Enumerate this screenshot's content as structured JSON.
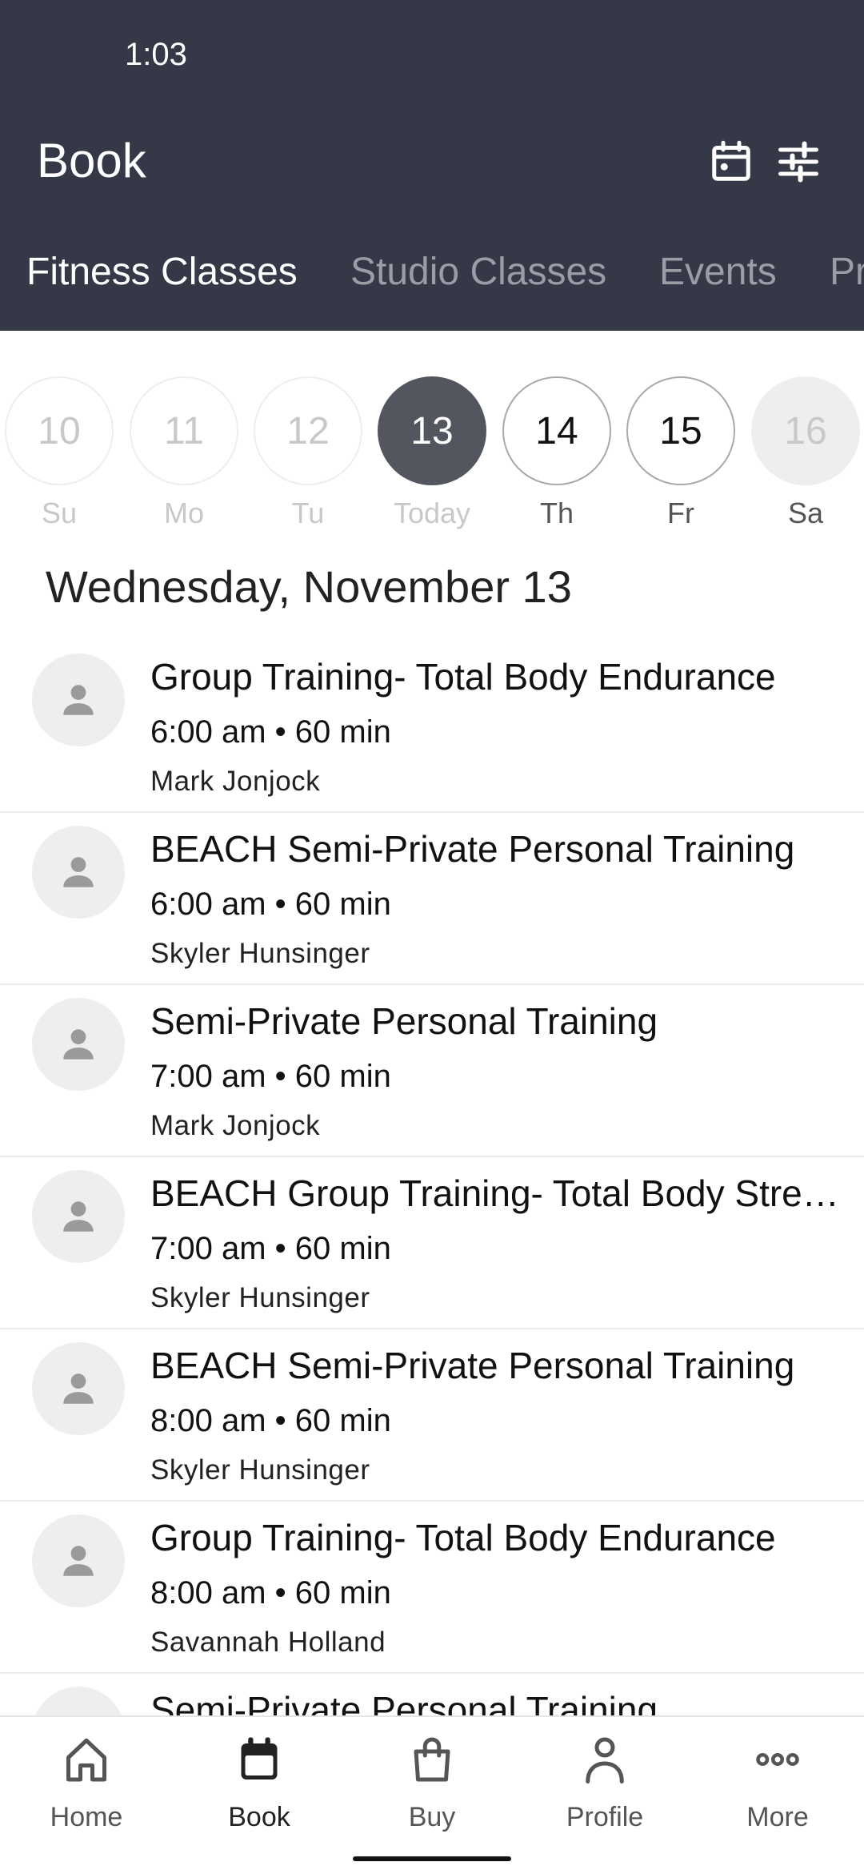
{
  "status_bar": {
    "time": "1:03"
  },
  "header": {
    "title": "Book",
    "calendar_icon": "calendar-icon",
    "filter_icon": "sliders-icon"
  },
  "tabs": [
    {
      "label": "Fitness Classes",
      "active": true
    },
    {
      "label": "Studio Classes",
      "active": false
    },
    {
      "label": "Events",
      "active": false
    },
    {
      "label": "Pr",
      "active": false
    }
  ],
  "dates": [
    {
      "num": "10",
      "label": "Su"
    },
    {
      "num": "11",
      "label": "Mo"
    },
    {
      "num": "12",
      "label": "Tu"
    },
    {
      "num": "13",
      "label": "Today"
    },
    {
      "num": "14",
      "label": "Th"
    },
    {
      "num": "15",
      "label": "Fr"
    },
    {
      "num": "16",
      "label": "Sa"
    }
  ],
  "date_heading": "Wednesday, November 13",
  "classes": [
    {
      "title": "Group Training- Total Body Endurance",
      "time": "6:00 am • 60 min",
      "instructor": "Mark Jonjock"
    },
    {
      "title": "BEACH Semi-Private Personal Training",
      "time": "6:00 am • 60 min",
      "instructor": "Skyler Hunsinger"
    },
    {
      "title": "Semi-Private Personal Training",
      "time": "7:00 am • 60 min",
      "instructor": "Mark Jonjock"
    },
    {
      "title": "BEACH Group Training- Total Body Stre…",
      "time": "7:00 am • 60 min",
      "instructor": "Skyler Hunsinger"
    },
    {
      "title": "BEACH Semi-Private Personal Training",
      "time": "8:00 am • 60 min",
      "instructor": "Skyler Hunsinger"
    },
    {
      "title": "Group Training- Total Body Endurance",
      "time": "8:00 am • 60 min",
      "instructor": "Savannah Holland"
    },
    {
      "title": "Semi-Private Personal Training",
      "time": "",
      "instructor": ""
    }
  ],
  "bottom_nav": [
    {
      "label": "Home",
      "icon": "home-icon"
    },
    {
      "label": "Book",
      "icon": "calendar-icon",
      "active": true
    },
    {
      "label": "Buy",
      "icon": "bag-icon"
    },
    {
      "label": "Profile",
      "icon": "person-icon"
    },
    {
      "label": "More",
      "icon": "more-icon"
    }
  ],
  "colors": {
    "header_bg": "#353846",
    "today_circle": "#54565f"
  }
}
